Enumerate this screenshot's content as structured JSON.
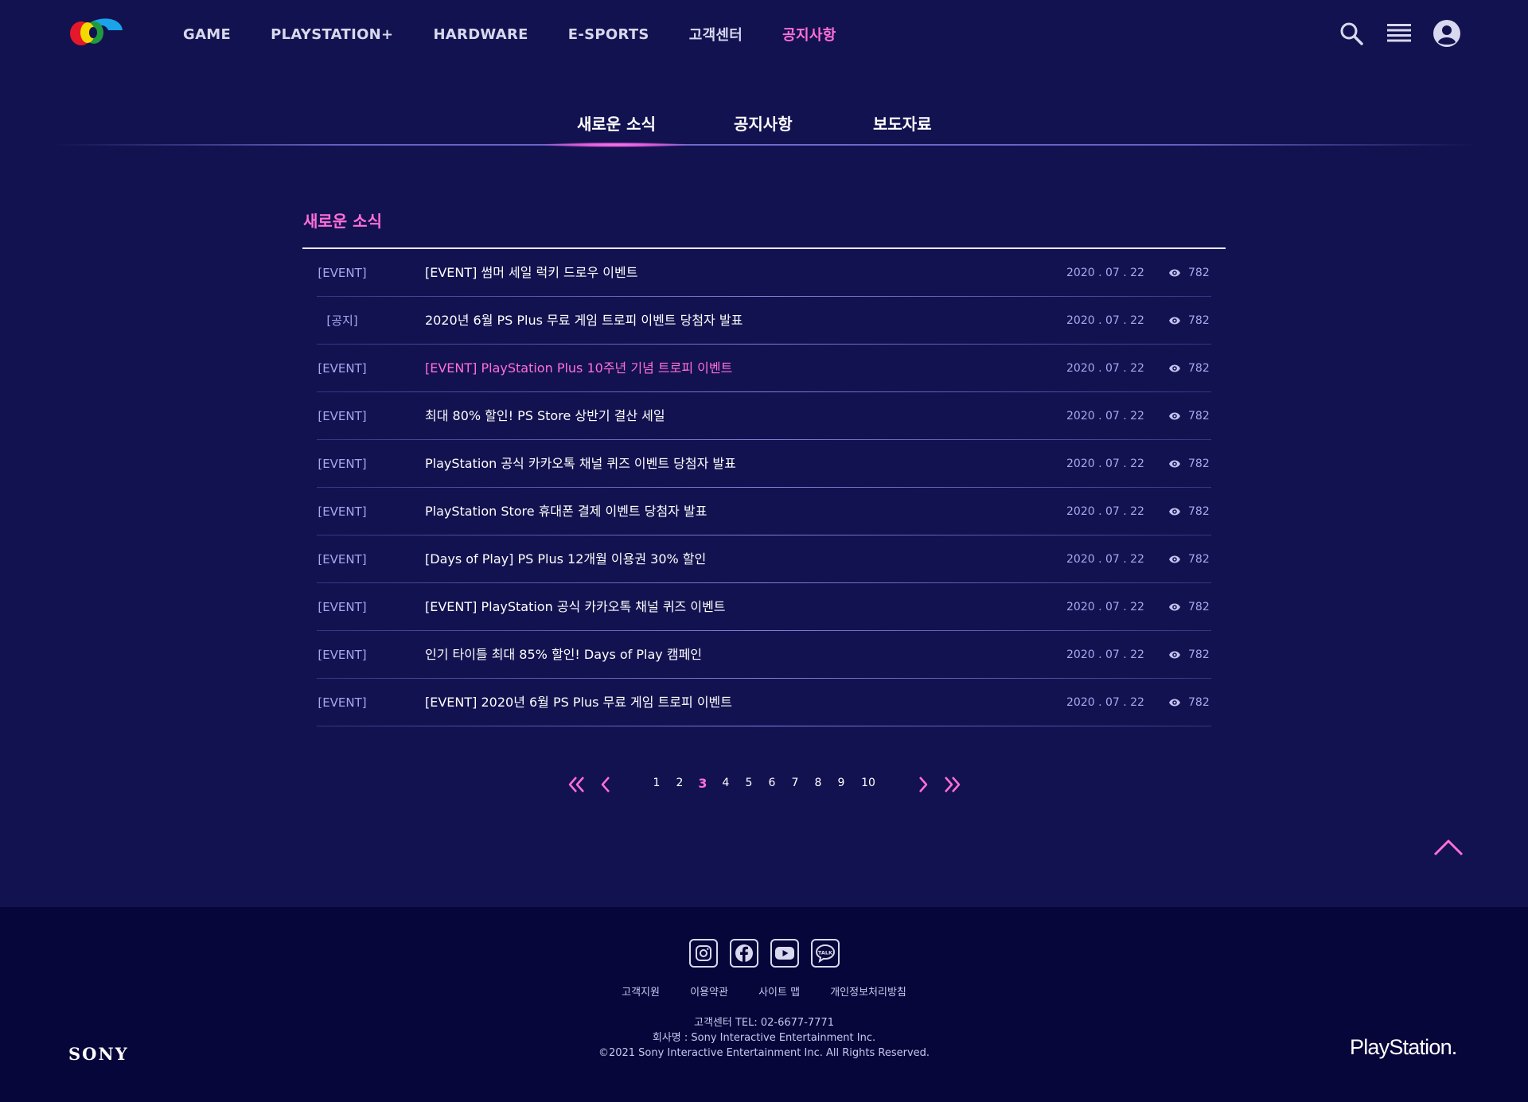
{
  "nav": {
    "items": [
      {
        "label": "GAME"
      },
      {
        "label": "PLAYSTATION+"
      },
      {
        "label": "HARDWARE"
      },
      {
        "label": "E-SPORTS"
      },
      {
        "label": "고객센터"
      },
      {
        "label": "공지사항",
        "active": true
      }
    ],
    "icons": [
      "search-icon",
      "menu-icon",
      "user-icon"
    ]
  },
  "tabs": [
    {
      "label": "새로운 소식",
      "active": true
    },
    {
      "label": "공지사항"
    },
    {
      "label": "보도자료"
    }
  ],
  "section": {
    "title": "새로운 소식",
    "rows": [
      {
        "category": "[EVENT]",
        "title": "[EVENT] 썸머 세일 럭키 드로우 이벤트",
        "date": "2020 . 07 . 22",
        "views": "782"
      },
      {
        "category": "[공지]",
        "title": "2020년 6월 PS Plus 무료 게임 트로피 이벤트 당첨자 발표",
        "date": "2020 . 07 . 22",
        "views": "782"
      },
      {
        "category": "[EVENT]",
        "title": "[EVENT] PlayStation Plus 10주년 기념 트로피 이벤트",
        "date": "2020 . 07 . 22",
        "views": "782",
        "highlight": true
      },
      {
        "category": "[EVENT]",
        "title": "최대 80% 할인! PS Store 상반기 결산 세일",
        "date": "2020 . 07 . 22",
        "views": "782"
      },
      {
        "category": "[EVENT]",
        "title": "PlayStation 공식 카카오톡 채널 퀴즈 이벤트 당첨자 발표",
        "date": "2020 . 07 . 22",
        "views": "782"
      },
      {
        "category": "[EVENT]",
        "title": "PlayStation Store 휴대폰 결제 이벤트 당첨자 발표",
        "date": "2020 . 07 . 22",
        "views": "782"
      },
      {
        "category": "[EVENT]",
        "title": "[Days of Play] PS Plus 12개월 이용권 30% 할인",
        "date": "2020 . 07 . 22",
        "views": "782"
      },
      {
        "category": "[EVENT]",
        "title": "[EVENT] PlayStation 공식 카카오톡 채널 퀴즈 이벤트",
        "date": "2020 . 07 . 22",
        "views": "782"
      },
      {
        "category": "[EVENT]",
        "title": "인기 타이틀 최대 85% 할인! Days of Play 캠페인",
        "date": "2020 . 07 . 22",
        "views": "782"
      },
      {
        "category": "[EVENT]",
        "title": "[EVENT] 2020년 6월 PS Plus 무료 게임 트로피 이벤트",
        "date": "2020 . 07 . 22",
        "views": "782"
      }
    ]
  },
  "pagination": {
    "pages": [
      "1",
      "2",
      "3",
      "4",
      "5",
      "6",
      "7",
      "8",
      "9",
      "10"
    ],
    "current": "3"
  },
  "footer": {
    "social": [
      "instagram-icon",
      "facebook-icon",
      "youtube-icon",
      "kakaotalk-icon"
    ],
    "kakao_label": "TALK",
    "links": [
      "고객지원",
      "이용약관",
      "사이트 맵",
      "개인정보처리방침"
    ],
    "tel": "고객센터 TEL: 02-6677-7771",
    "company": "회사명 : Sony Interactive Entertainment Inc.",
    "copyright": "©2021 Sony Interactive Entertainment Inc. All Rights Reserved.",
    "sony": "SONY",
    "playstation": "PlayStation."
  },
  "colors": {
    "background": "#131250",
    "footer": "#06063a",
    "accent": "#ff6fd8",
    "muted": "#a9a6f0"
  }
}
